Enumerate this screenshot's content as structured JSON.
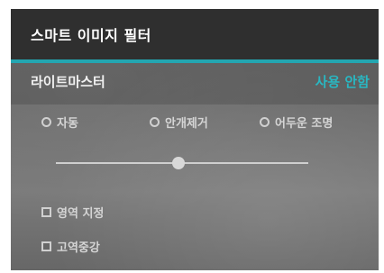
{
  "window": {
    "title": "스마트 이미지 필터"
  },
  "section": {
    "title": "라이트마스터",
    "status": "사용 안함"
  },
  "options": {
    "radios": [
      {
        "label": "자동"
      },
      {
        "label": "안개제거"
      },
      {
        "label": "어두운 조명"
      }
    ],
    "slider": {
      "value": 0.5
    },
    "checkboxes": [
      {
        "label": "영역 지정",
        "checked": false
      },
      {
        "label": "고역중강",
        "checked": false
      }
    ]
  },
  "colors": {
    "accent": "#23a6b1",
    "status_text": "#29b7c2",
    "title_bar": "#2f2f2f"
  }
}
